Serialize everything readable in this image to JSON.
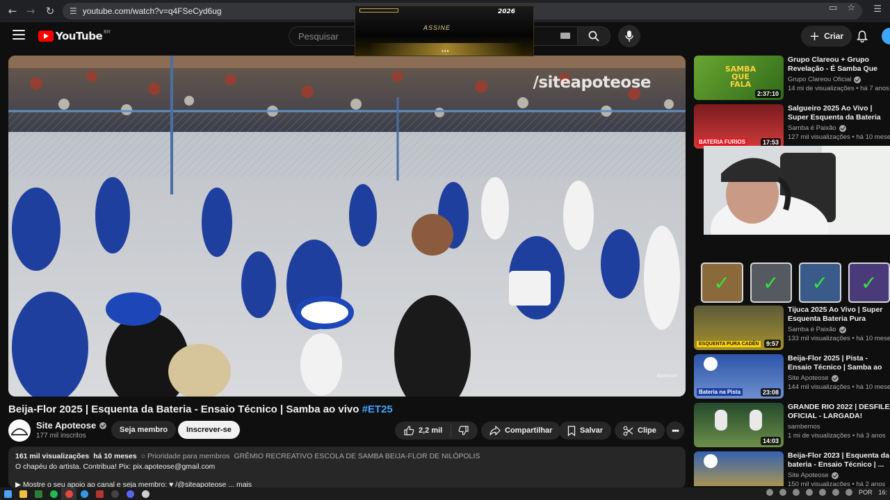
{
  "browser": {
    "url": "youtube.com/watch?v=q4FSeCyd6ug",
    "back_icon": "arrow-left-icon",
    "forward_icon": "arrow-right-icon",
    "reload_icon": "reload-icon"
  },
  "header": {
    "logo_text": "YouTube",
    "country_code": "BR",
    "search_placeholder": "Pesquisar",
    "create_label": "Criar"
  },
  "ad": {
    "brand": "2026",
    "cta": "ASSINE",
    "dots": "•••"
  },
  "video": {
    "watermark": "/siteapoteose",
    "corner_mark": "Apoteose",
    "title": "Beija-Flor 2025 | Esquenta da Bateria - Ensaio Técnico | Samba ao vivo ",
    "hashtag": "#ET25"
  },
  "channel": {
    "name": "Site Apoteose",
    "subscribers": "177 mil inscritos",
    "join_label": "Seja membro",
    "subscribe_label": "Inscrever-se"
  },
  "actions": {
    "likes": "2,2 mil",
    "share_label": "Compartilhar",
    "save_label": "Salvar",
    "clip_label": "Clipe",
    "more_label": "•••"
  },
  "description": {
    "views": "161 mil visualizações",
    "age": "há 10 meses",
    "priority": "○ Prioridade para membros",
    "org": "GRÊMIO RECREATIVO ESCOLA DE SAMBA BEIJA-FLOR DE NILÓPOLIS",
    "line2": "O chapéu do artista. Contribua! Pix: pix.apoteose@gmail.com",
    "line3": "▶ Mostre o seu apoio ao canal e seja membro: ♥ /@siteapoteose ... mais"
  },
  "recommendations": [
    {
      "title": "Grupo Clareou + Grupo Revelação - É Samba Que Fala",
      "channel": "Grupo Clareou Oficial",
      "meta": "14 mi de visualizações • há 7 anos",
      "duration": "2:37:10",
      "thumb_color": "#4a8a2c",
      "thumb_label": "SAMBA QUE FALA"
    },
    {
      "title": "Salgueiro 2025 Ao Vivo | Super Esquenta da Bateria Furiosa | ...",
      "channel": "Samba é Paixão",
      "meta": "127 mil visualizações • há 10 meses",
      "duration": "17:53",
      "thumb_color": "#b51f24",
      "thumb_label": "BATERIA FURIOS"
    },
    {
      "title": "Tijuca 2025 Ao Vivo | Super Esquenta Bateria Pura Cadência",
      "channel": "Samba é Paixão",
      "meta": "133 mil visualizações • há 10 meses",
      "duration": "9:57",
      "thumb_color": "#8a7a32",
      "thumb_label": "ESQUENTA PURA CADÊN"
    },
    {
      "title": "Beija-Flor 2025 | Pista - Ensaio Técnico | Samba ao vivo #ET2",
      "channel": "Site Apoteose",
      "meta": "144 mil visualizações • há 10 meses",
      "duration": "23:08",
      "thumb_color": "#2b4f9e",
      "thumb_label": "Bateria na Pista"
    },
    {
      "title": "GRANDE RIO 2022 | DESFILE OFICIAL - LARGADA!",
      "channel": "sambemos",
      "meta": "1 mi de visualizações • há 3 anos",
      "duration": "14:03",
      "thumb_color": "#2e6a3a",
      "thumb_label": ""
    },
    {
      "title": "Beija-Flor 2023 | Esquenta da bateria - Ensaio Técnico | ...",
      "channel": "Site Apoteose",
      "meta": "150 mil visualizações • há 2 anos",
      "duration": "",
      "thumb_color": "#3561b0",
      "thumb_label": ""
    }
  ],
  "taskbar": {
    "language": "POR",
    "time": "16:"
  }
}
